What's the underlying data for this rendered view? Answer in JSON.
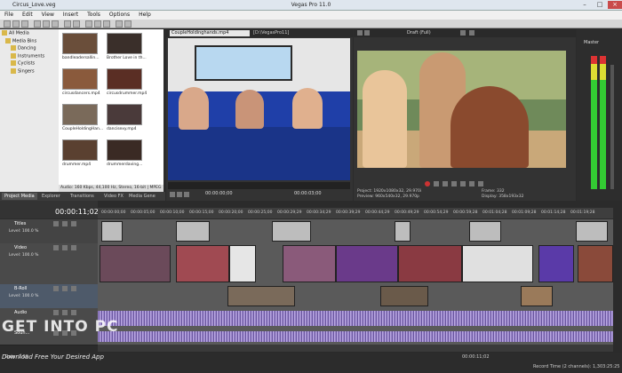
{
  "window": {
    "file_title": "Circus_Love.veg",
    "app_title": "Vegas Pro 11.0"
  },
  "menu": [
    "File",
    "Edit",
    "View",
    "Insert",
    "Tools",
    "Options",
    "Help"
  ],
  "explorer_tree": [
    "All Media",
    "Media Bins",
    "Dancing",
    "Instruments",
    "Cyclists",
    "Singers"
  ],
  "media_items": [
    {
      "label": "bandleadersallin...",
      "color": "#6a4e3a"
    },
    {
      "label": "Brother Love in th...",
      "color": "#3a2f2a"
    },
    {
      "label": "circusdancers.mp4",
      "color": "#8a5a3c"
    },
    {
      "label": "circusdrummer.mp4",
      "color": "#5a2e24"
    },
    {
      "label": "CoupleHoldingHan...",
      "color": "#7a6a5a"
    },
    {
      "label": "dancisexy.mp4",
      "color": "#4a3a3a"
    },
    {
      "label": "drummer.mp4",
      "color": "#5a4030"
    },
    {
      "label": "drummerdaving...",
      "color": "#3a2a24"
    }
  ],
  "media_info": "Audio: 160 Kbps, 44,100 Hz, Stereo, 16-bit | MPEG",
  "left_tabs": [
    "Project Media",
    "Explorer",
    "Transitions",
    "Video FX",
    "Media Gene"
  ],
  "trimmer": {
    "file": "CoupleHoldinghands.mp4",
    "path": "[D:\\VegasPro11]",
    "time_in": "00:00:00;00",
    "time_out": "00:00:03;00"
  },
  "preview": {
    "quality": "Draft (Full)",
    "project": "Project: 1920x1080x32, 29.970i",
    "preview_res": "Preview: 960x540x32, 29.970p",
    "display": "Display: 960x540x32, 29.970",
    "frame": "Frame: 332",
    "display_size": "Display: 358x193x32"
  },
  "master": {
    "label": "Master"
  },
  "timeline": {
    "current_time": "00:00:11;02",
    "ruler": [
      "00:00:00;00",
      "00:00:05;00",
      "00:00:10;00",
      "00:00:15;00",
      "00:00:20;00",
      "00:00:25;00",
      "00:00:29;29",
      "00:00:34;29",
      "00:00:39;29",
      "00:00:44;29",
      "00:00:49;29",
      "00:00:54;29",
      "00:00:59;28",
      "00:01:04;28",
      "00:01:09;28",
      "00:01:14;28",
      "00:01:19;28"
    ],
    "tracks": [
      {
        "name": "Titles",
        "level": "Level: 100.0 %"
      },
      {
        "name": "Video",
        "level": "Level: 100.0 %"
      },
      {
        "name": "B-Roll",
        "level": "Level: 100.0 %"
      },
      {
        "name": "Audio",
        "level": ""
      },
      {
        "name": "Soun...",
        "level": ""
      }
    ],
    "rate": "Rate: 1.00",
    "end_time": "00:00:11;02",
    "status": "Record Time (2 channels): 1,303:25:25"
  },
  "watermark": {
    "line1": "GET INTO PC",
    "line2": "Download Free Your Desired App"
  }
}
